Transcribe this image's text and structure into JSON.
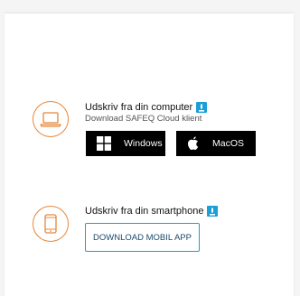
{
  "computer_section": {
    "icon": "laptop-icon",
    "title": "Udskriv fra din computer",
    "info_icon": "info-icon",
    "subtitle": "Download SAFEQ Cloud klient",
    "buttons": [
      {
        "label": "Windows",
        "icon": "windows-icon"
      },
      {
        "label": "MacOS",
        "icon": "apple-icon"
      }
    ]
  },
  "smartphone_section": {
    "icon": "smartphone-icon",
    "title": "Udskriv fra din smartphone",
    "info_icon": "info-icon",
    "button_label": "DOWNLOAD MOBIL APP"
  },
  "colors": {
    "accent_orange": "#e8873a",
    "info_blue": "#1a9fd6",
    "button_black": "#000000"
  }
}
